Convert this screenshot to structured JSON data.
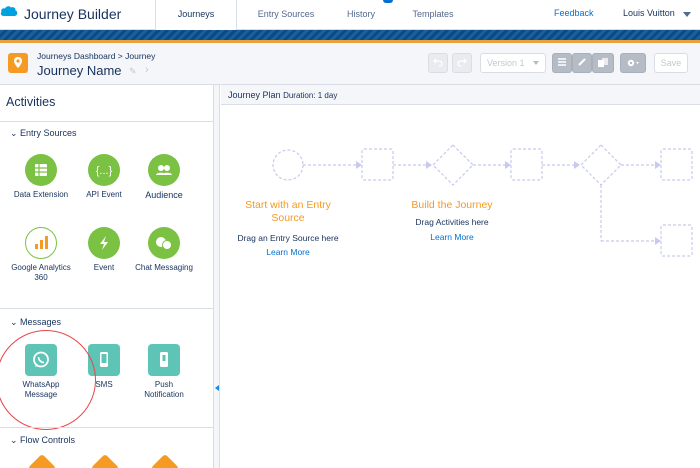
{
  "app": {
    "title": "Journey Builder",
    "user": "Louis Vuitton",
    "feedback": "Feedback"
  },
  "nav": {
    "tabs": [
      "Journeys",
      "Entry Sources",
      "History",
      "Templates"
    ],
    "active": "Journeys"
  },
  "header": {
    "breadcrumb": "Journeys Dashboard > Journey",
    "journey_name": "Journey Name",
    "version": "Version 1",
    "save": "Save"
  },
  "sidebar": {
    "title": "Activities",
    "sections": {
      "entry_sources": {
        "label": "Entry Sources",
        "items": [
          "Data Extension",
          "API Event",
          "Audience",
          "Google Analytics 360",
          "Event",
          "Chat Messaging"
        ]
      },
      "messages": {
        "label": "Messages",
        "items": [
          "WhatsApp Message",
          "SMS",
          "Push Notification"
        ]
      },
      "flow_controls": {
        "label": "Flow Controls"
      }
    }
  },
  "canvas": {
    "plan_label": "Journey Plan",
    "duration": "Duration: 1 day",
    "entry": {
      "title": "Start with an Entry Source",
      "text": "Drag an Entry Source here",
      "link": "Learn More"
    },
    "build": {
      "title": "Build the Journey",
      "text": "Drag Activities here",
      "link": "Learn More"
    }
  },
  "colors": {
    "accent_orange": "#f59a23",
    "activity_green": "#7bc143",
    "message_teal": "#5ec4b6",
    "link_blue": "#0070d2",
    "highlight_red": "#e8464a"
  }
}
